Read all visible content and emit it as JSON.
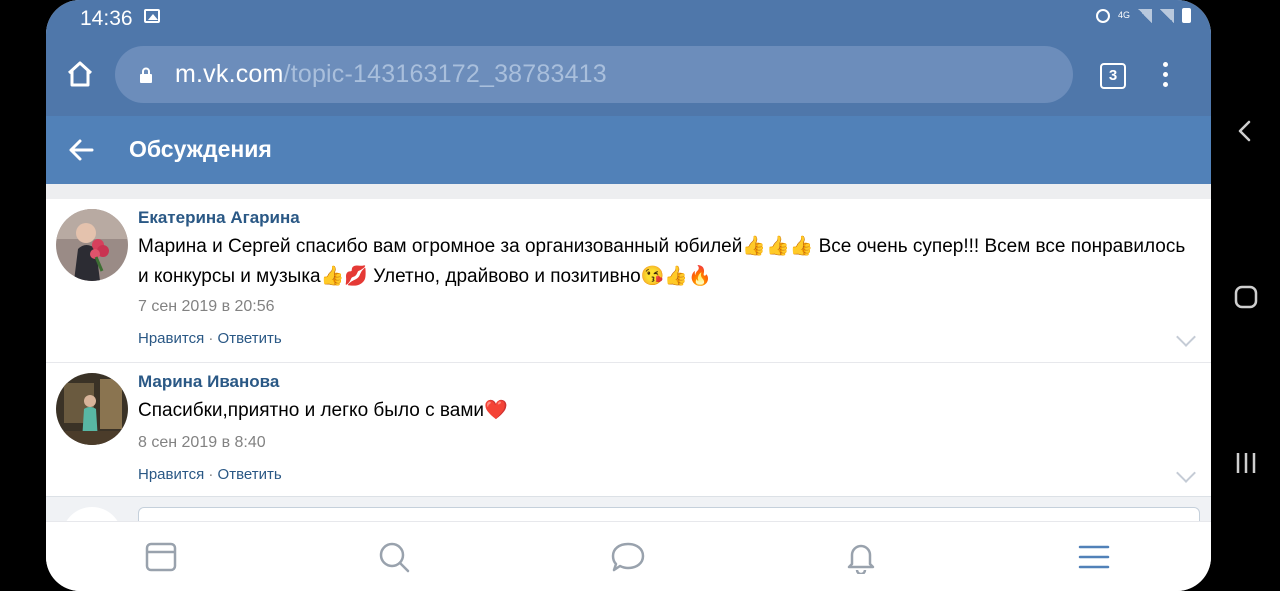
{
  "status_bar": {
    "time": "14:36",
    "network": "4G",
    "icons": [
      "image-icon",
      "alarm-icon",
      "signal-icon",
      "signal-icon",
      "battery-icon"
    ]
  },
  "browser": {
    "url_host": "m.vk.com",
    "url_path": "/topic-143163172_38783413",
    "tab_count": "3"
  },
  "header": {
    "title": "Обсуждения"
  },
  "comments": [
    {
      "author": "Екатерина Агарина",
      "text_line1": "Марина и Сергей спасибо вам огромное за организованный юбилей👍👍👍 Все очень супер!!! Всем все понравилось",
      "text_line2": "и конкурсы и музыка👍💋 Улетно, драйвово и позитивно😘👍🔥",
      "date": "7 сен 2019 в 20:56",
      "like_label": "Нравится",
      "separator": " · ",
      "reply_label": "Ответить"
    },
    {
      "author": "Марина Иванова",
      "text_line1": "Спасибки,приятно и легко было с вами❤️",
      "date": "8 сен 2019 в 8:40",
      "like_label": "Нравится",
      "separator": " · ",
      "reply_label": "Ответить"
    }
  ],
  "bottom_nav": {
    "items": [
      "news-icon",
      "search-icon",
      "messages-icon",
      "notifications-icon",
      "menu-icon"
    ]
  },
  "colors": {
    "vk_blue": "#4f77aa",
    "header_blue": "#5181b8",
    "link_blue": "#2a5885"
  }
}
